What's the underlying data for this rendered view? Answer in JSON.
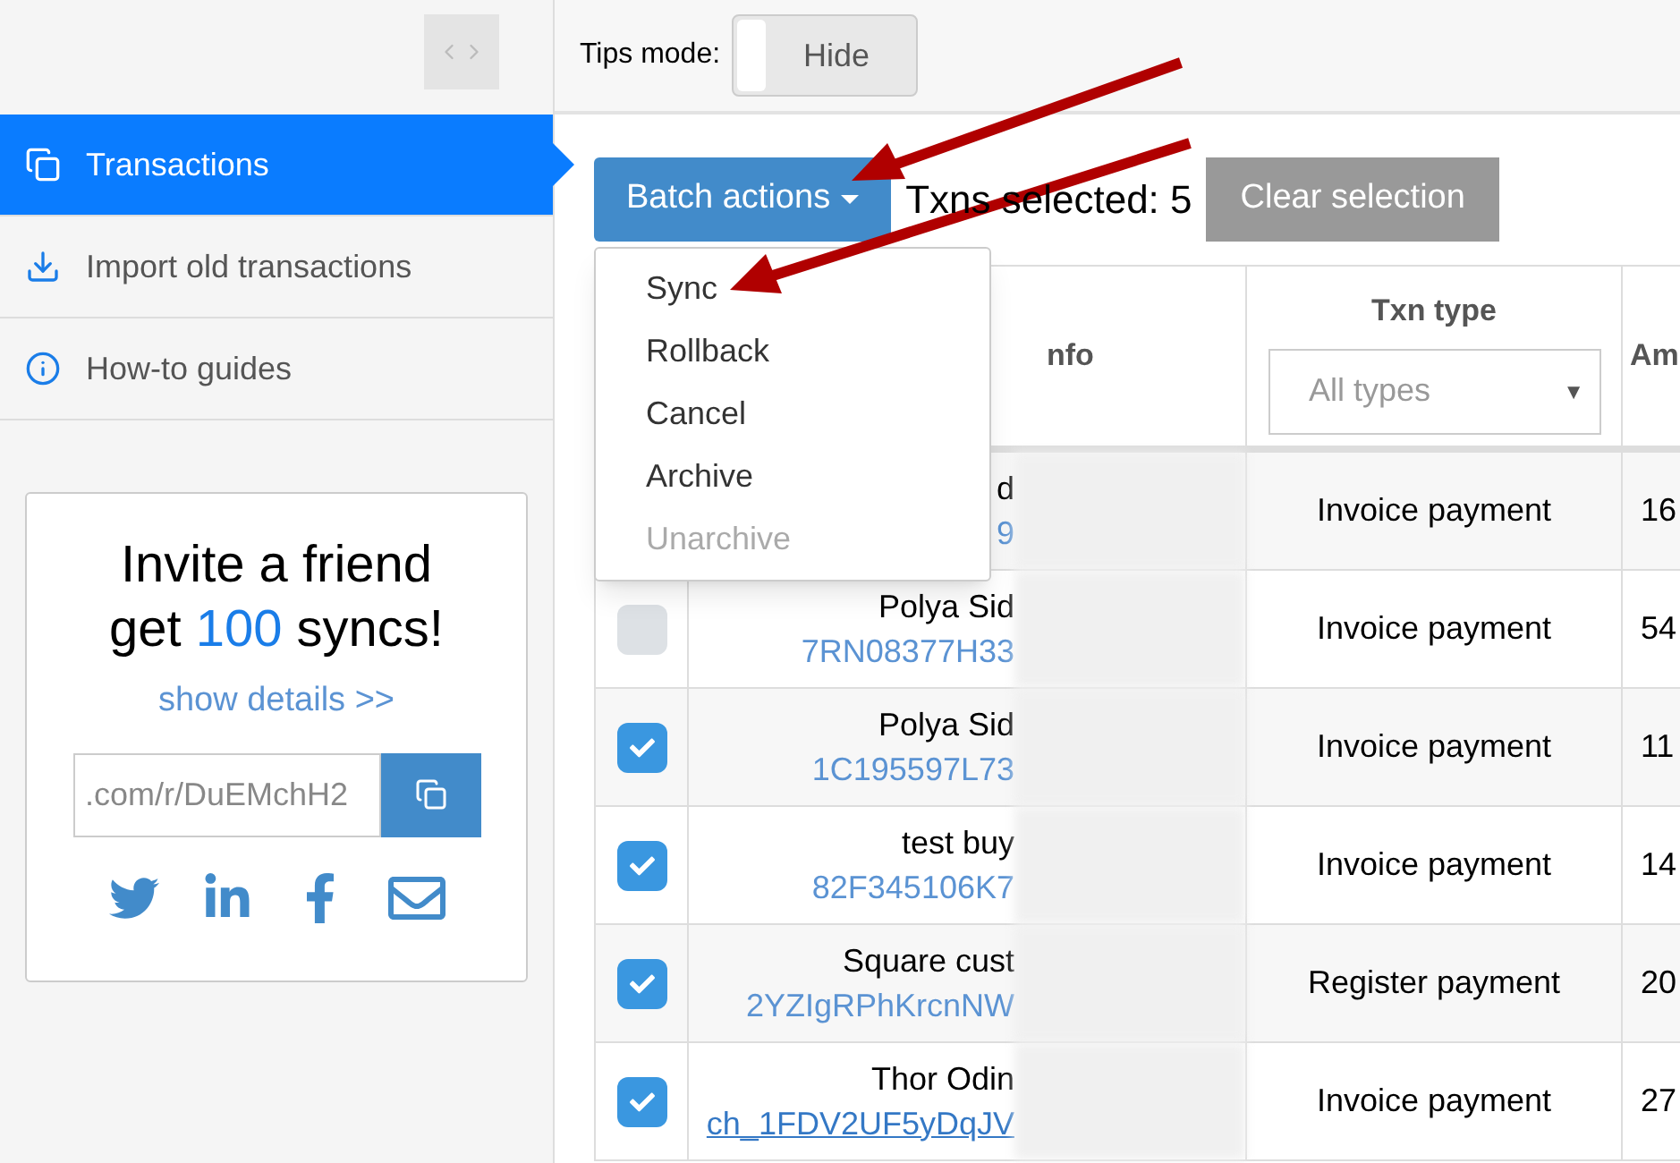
{
  "sidebar": {
    "items": [
      {
        "label": "Transactions",
        "kind": "copy",
        "selected": true
      },
      {
        "label": "Import old transactions",
        "kind": "download",
        "selected": false
      },
      {
        "label": "How-to guides",
        "kind": "info",
        "selected": false
      }
    ],
    "invite": {
      "title_line1": "Invite a friend",
      "title_pre": "get ",
      "title_number": "100",
      "title_post": " syncs!",
      "details_link": "show details >>",
      "referral_value": ".com/r/DuEMchH2"
    }
  },
  "top_bar": {
    "tips_label": "Tips mode:",
    "tips_toggle": {
      "label": "Hide",
      "on": false
    }
  },
  "toolbar": {
    "batch_button": "Batch actions",
    "selected_count": "Txns selected: 5",
    "clear_button": "Clear selection"
  },
  "batch_menu": {
    "items": [
      {
        "label": "Sync",
        "disabled": false
      },
      {
        "label": "Rollback",
        "disabled": false
      },
      {
        "label": "Cancel",
        "disabled": false
      },
      {
        "label": "Archive",
        "disabled": false
      },
      {
        "label": "Unarchive",
        "disabled": true
      }
    ]
  },
  "table": {
    "columns": [
      {
        "label": "nfo"
      },
      {
        "label": "Txn type",
        "filter_placeholder": "All types",
        "filter_arrow": "▼"
      },
      {
        "label": "Am"
      }
    ],
    "rows": [
      {
        "name": "d",
        "ref": "9",
        "link": false,
        "type": "Invoice payment",
        "amount": "16"
      },
      {
        "checked": false,
        "name": "Polya Sid",
        "ref": "7RN08377H33",
        "link": false,
        "type": "Invoice payment",
        "amount": "54"
      },
      {
        "checked": true,
        "name": "Polya Sid",
        "ref": "1C195597L73",
        "link": false,
        "type": "Invoice payment",
        "amount": "11"
      },
      {
        "checked": true,
        "name": "test buy",
        "ref": "82F345106K7",
        "link": false,
        "type": "Invoice payment",
        "amount": "14"
      },
      {
        "checked": true,
        "name": "Square cust",
        "ref": "2YZIgRPhKrcnNW",
        "link": false,
        "type": "Register payment",
        "amount": "20"
      },
      {
        "checked": true,
        "name": "Thor Odin",
        "ref": "ch_1FDV2UF5yDqJV",
        "link": true,
        "type": "Invoice payment",
        "amount": "27"
      }
    ]
  }
}
